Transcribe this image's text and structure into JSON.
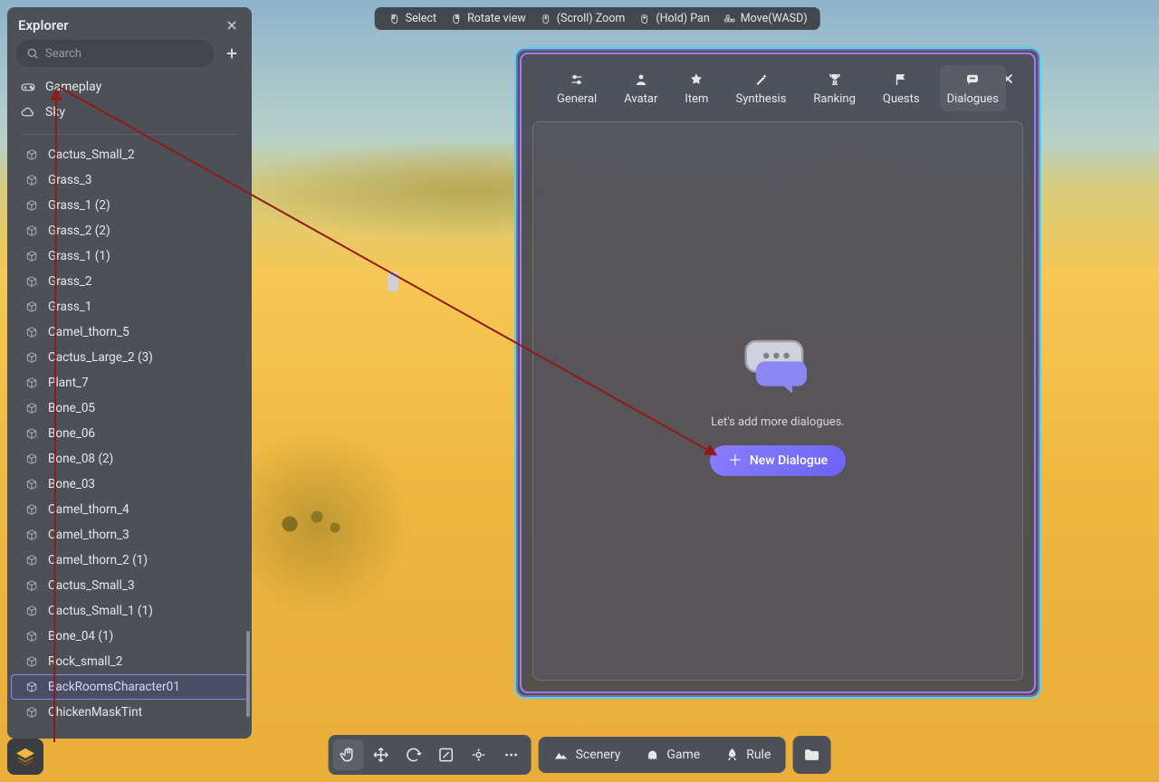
{
  "explorer": {
    "title": "Explorer",
    "search_placeholder": "Search",
    "top_items": [
      {
        "label": "Gameplay",
        "icon": "gamepad-icon"
      },
      {
        "label": "Sky",
        "icon": "cloud-icon"
      }
    ],
    "objects": [
      "Cactus_Small_2",
      "Grass_3",
      "Grass_1 (2)",
      "Grass_2 (2)",
      "Grass_1 (1)",
      "Grass_2",
      "Grass_1",
      "Camel_thorn_5",
      "Cactus_Large_2 (3)",
      "Plant_7",
      "Bone_05",
      "Bone_06",
      "Bone_08 (2)",
      "Bone_03",
      "Camel_thorn_4",
      "Camel_thorn_3",
      "Camel_thorn_2 (1)",
      "Cactus_Small_3",
      "Cactus_Small_1 (1)",
      "Bone_04 (1)",
      "Rock_small_2",
      "BackRoomsCharacter01",
      "ChickenMaskTint"
    ],
    "selected_index": 21
  },
  "hints": [
    {
      "label": "Select",
      "icon": "mouse-left-icon"
    },
    {
      "label": "Rotate view",
      "icon": "mouse-right-icon"
    },
    {
      "label": "(Scroll) Zoom",
      "icon": "mouse-scroll-icon"
    },
    {
      "label": "(Hold) Pan",
      "icon": "mouse-middle-icon"
    },
    {
      "label": "Move(WASD)",
      "icon": "keyboard-icon"
    }
  ],
  "properties": {
    "tabs": [
      {
        "label": "General",
        "icon": "sliders-icon"
      },
      {
        "label": "Avatar",
        "icon": "person-icon"
      },
      {
        "label": "Item",
        "icon": "star-icon"
      },
      {
        "label": "Synthesis",
        "icon": "wand-icon"
      },
      {
        "label": "Ranking",
        "icon": "trophy-icon"
      },
      {
        "label": "Quests",
        "icon": "flag-icon"
      },
      {
        "label": "Dialogues",
        "icon": "chat-icon"
      }
    ],
    "active_tab_index": 6,
    "empty_text": "Let's add more dialogues.",
    "new_button_label": "New Dialogue"
  },
  "bottom": {
    "modes": [
      {
        "label": "Scenery",
        "icon": "mountain-icon"
      },
      {
        "label": "Game",
        "icon": "ghost-icon"
      },
      {
        "label": "Rule",
        "icon": "rocket-icon"
      }
    ]
  }
}
